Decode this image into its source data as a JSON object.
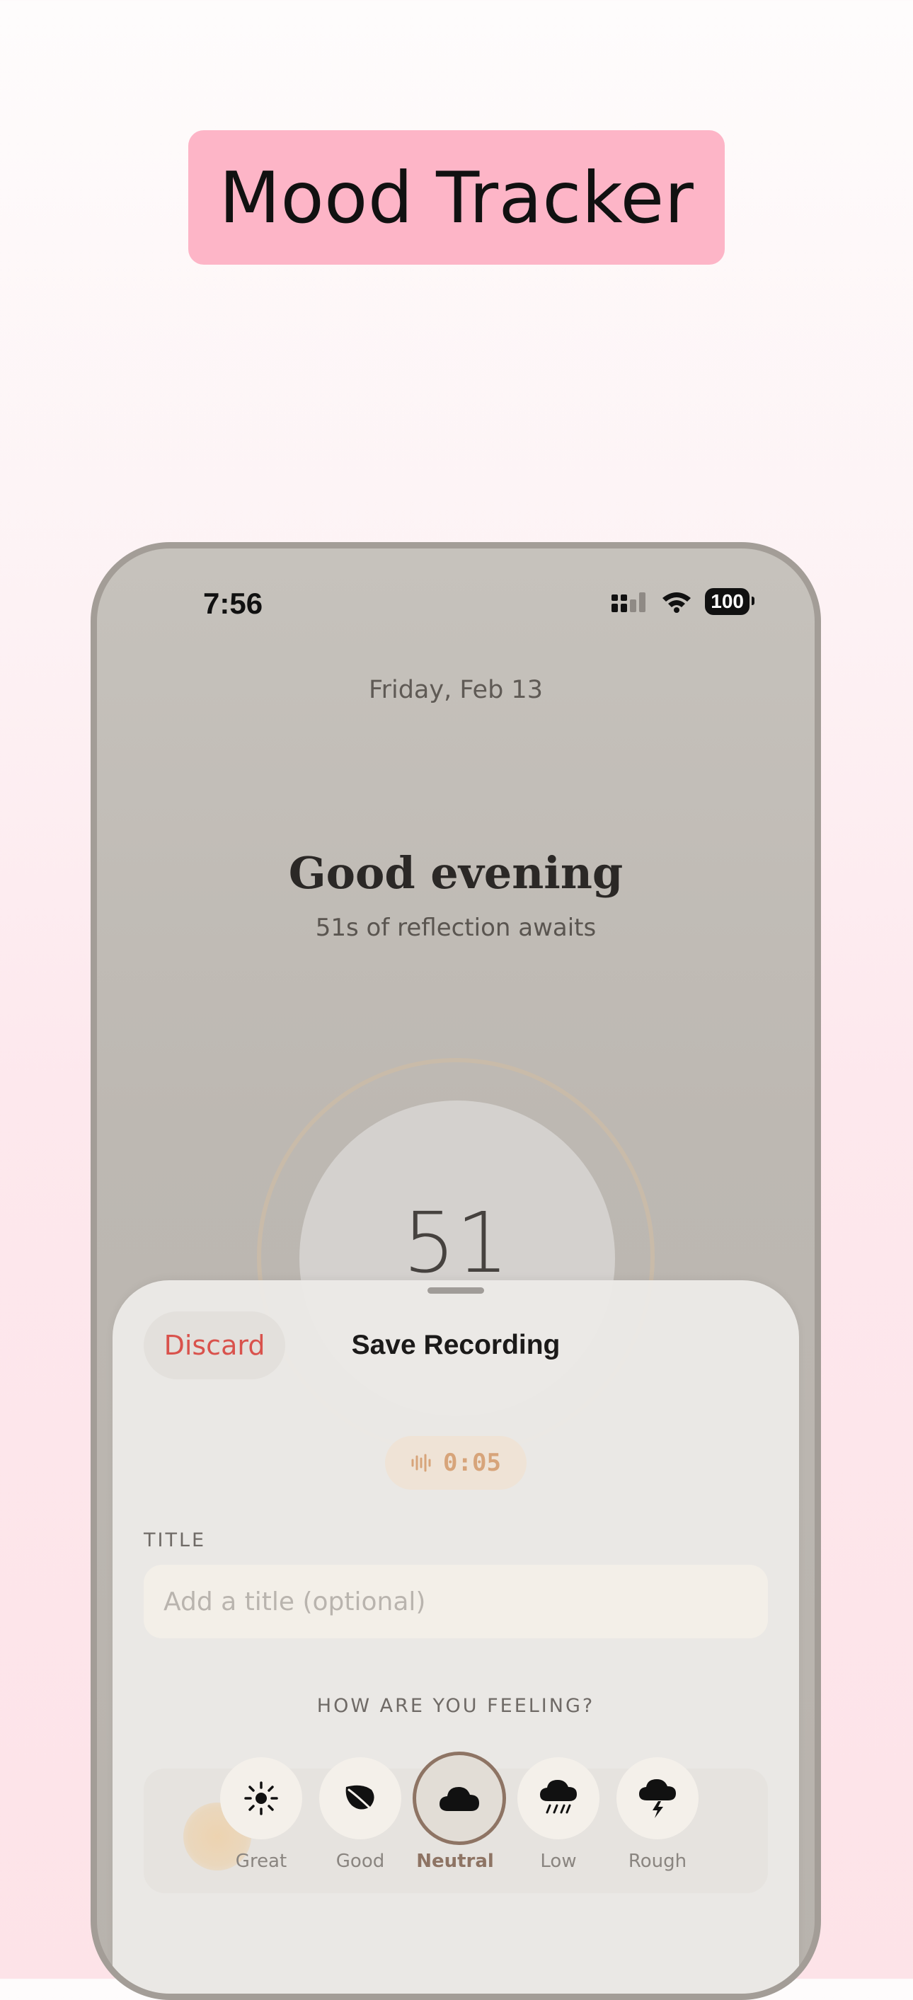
{
  "banner": {
    "title": "Mood Tracker"
  },
  "status_bar": {
    "time": "7:56",
    "battery": "100"
  },
  "home": {
    "date": "Friday, Feb 13",
    "greeting": "Good evening",
    "subtitle": "51s of reflection awaits",
    "countdown": "51"
  },
  "sheet": {
    "discard_label": "Discard",
    "title": "Save Recording",
    "duration": "0:05",
    "title_field_label": "TITLE",
    "title_placeholder": "Add a title (optional)",
    "feeling_label": "HOW ARE YOU FEELING?",
    "moods": [
      {
        "label": "Great",
        "icon": "sun-icon"
      },
      {
        "label": "Good",
        "icon": "leaf-icon"
      },
      {
        "label": "Neutral",
        "icon": "cloud-icon",
        "selected": true
      },
      {
        "label": "Low",
        "icon": "rain-icon"
      },
      {
        "label": "Rough",
        "icon": "storm-icon"
      }
    ]
  },
  "colors": {
    "banner_bg": "#fdb5c7",
    "discard": "#d9524c",
    "accent_brown": "#8e7464",
    "duration_text": "#d7a47a",
    "primary_button": "#e79b6a"
  }
}
